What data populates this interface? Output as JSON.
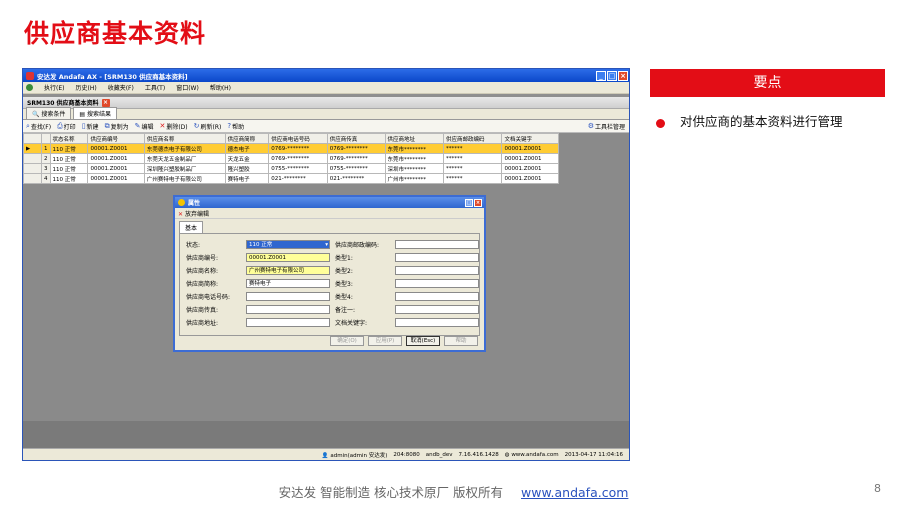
{
  "slide": {
    "title": "供应商基本资料",
    "panel_header": "要点",
    "bullet": "对供应商的基本资料进行管理",
    "footer_text": "安达发   智能制造 核心技术原厂   版权所有",
    "footer_link": "www.andafa.com",
    "page_number": "8"
  },
  "window": {
    "title": "安达发 Andafa AX - [SRM130 供应商基本资料]",
    "buttons": {
      "min": "_",
      "max": "□",
      "close": "×"
    }
  },
  "menu": [
    "执行(E)",
    "历史(H)",
    "收藏夹(F)",
    "工具(T)",
    "窗口(W)",
    "帮助(H)"
  ],
  "mdi": {
    "title": "SRM130 供应商基本资料",
    "close": "×"
  },
  "tabs": [
    "搜索条件",
    "搜索结果"
  ],
  "toolbar": {
    "find": "查找(F)",
    "print": "打印",
    "new": "新建",
    "copy": "复制为",
    "edit": "编辑",
    "delete": "删除(D)",
    "refresh": "刷新(R)",
    "help": "帮助",
    "tools": "工具栏管理"
  },
  "table": {
    "headers": [
      "状态名称",
      "供应商编号",
      "供应商名称",
      "供应商简称",
      "供应商电话号码",
      "供应商传真",
      "供应商地址",
      "供应商邮政编码",
      "文档关键字"
    ],
    "rows": [
      {
        "n": "1",
        "cells": [
          "110 正常",
          "00001.Z0001",
          "东莞德杰电子有限公司",
          "德杰电子",
          "0769-********",
          "0769-********",
          "东莞市********",
          "******",
          "00001.Z0001"
        ]
      },
      {
        "n": "2",
        "cells": [
          "110 正常",
          "00001.Z0001",
          "东莞天龙五金制品厂",
          "天龙五金",
          "0769-********",
          "0769-********",
          "东莞市********",
          "******",
          "00001.Z0001"
        ]
      },
      {
        "n": "3",
        "cells": [
          "110 正常",
          "00001.Z0001",
          "深圳隆兴塑胶制品厂",
          "隆兴塑胶",
          "0755-********",
          "0755-********",
          "深圳市********",
          "******",
          "00001.Z0001"
        ]
      },
      {
        "n": "4",
        "cells": [
          "110 正常",
          "00001.Z0001",
          "广州赛特电子有限公司",
          "赛特电子",
          "021-********",
          "021-********",
          "广州市********",
          "******",
          "00001.Z0001"
        ]
      }
    ]
  },
  "dialog": {
    "title": "属性",
    "tool": "放弃编辑",
    "tab": "基本",
    "left_fields": [
      {
        "label": "状态:",
        "value": "110 正常"
      },
      {
        "label": "供应商编号:",
        "value": "00001.Z0001"
      },
      {
        "label": "供应商名称:",
        "value": "广州赛特电子有限公司"
      },
      {
        "label": "供应商简称:",
        "value": "赛特电子"
      },
      {
        "label": "供应商电话号码:",
        "value": ""
      },
      {
        "label": "供应商传真:",
        "value": ""
      },
      {
        "label": "供应商地址:",
        "value": ""
      }
    ],
    "right_fields": [
      {
        "label": "供应商邮政编码:",
        "value": ""
      },
      {
        "label": "类型1:",
        "value": ""
      },
      {
        "label": "类型2:",
        "value": ""
      },
      {
        "label": "类型3:",
        "value": ""
      },
      {
        "label": "类型4:",
        "value": ""
      },
      {
        "label": "备注一:",
        "value": ""
      },
      {
        "label": "文档关键字:",
        "value": ""
      }
    ],
    "buttons": {
      "ok": "确定(O)",
      "apply": "应用(P)",
      "cancel": "取消(Esc)",
      "help": "帮助"
    }
  },
  "status": {
    "user": "admin(admin 安达发)",
    "port": "204:8080",
    "db": "andb_dev",
    "ip": "7.16.416.1428",
    "site": "www.andafa.com",
    "datetime": "2013-04-17 11:04:16"
  },
  "colors": {
    "brand_red": "#e30d16",
    "selected_row": "#ffcc33",
    "title_blue": "#0b47c9"
  }
}
